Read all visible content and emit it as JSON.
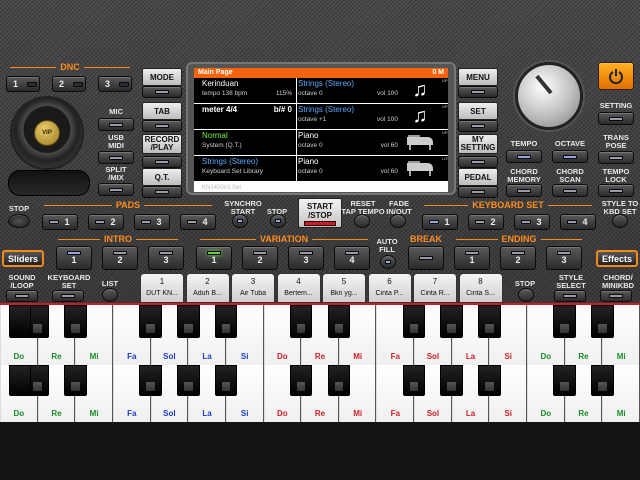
{
  "dnc": {
    "label": "DNC",
    "buttons": [
      "1",
      "2",
      "3"
    ]
  },
  "mode": {
    "label": "MODE"
  },
  "tab": {
    "label": "TAB"
  },
  "record": {
    "label": "RECORD\n/PLAY"
  },
  "qt": {
    "label": "Q.T."
  },
  "mic": {
    "label": "MIC"
  },
  "usb": {
    "label": "USB\nMIDI"
  },
  "split": {
    "label": "SPLIT\n/MIX"
  },
  "vip": {
    "label": "VIP"
  },
  "screen": {
    "header_left": "Main Page",
    "header_right": "0 M",
    "rows": [
      {
        "l1": "Kerinduan",
        "l2a": "tempo 138 bpm",
        "l2b": "115%",
        "r1": "Strings (Stereo)",
        "r2a": "octave 0",
        "r2b": "vol 100",
        "side": "UP1",
        "pic": "note"
      },
      {
        "l1": "meter 4/4",
        "l1b": "b/# 0",
        "l2a": "",
        "l2b": "",
        "r1": "Strings (Stereo)",
        "r2a": "octave +1",
        "r2b": "vol 100",
        "side": "UP2",
        "pic": "note"
      },
      {
        "l1": "Normal",
        "l2a": "System (Q.T.)",
        "l2b": "",
        "r1": "Piano",
        "r2a": "octave 0",
        "r2b": "vol 60",
        "side": "UP3",
        "pic": "piano"
      },
      {
        "l1": "Strings (Stereo)",
        "l2a": "Keyboard Set Library",
        "l2b": "",
        "r1": "Piano",
        "r2a": "octave 0",
        "r2b": "vol 60",
        "side": "LOW",
        "pic": "piano"
      }
    ],
    "footer": "KN1400#3.Set"
  },
  "menu": {
    "label": "MENU"
  },
  "set": {
    "label": "SET"
  },
  "my_setting": {
    "label": "MY\nSETTING"
  },
  "pedal": {
    "label": "PEDAL"
  },
  "setting": {
    "label": "SETTING"
  },
  "transpose": {
    "label": "TRANS\nPOSE"
  },
  "tempo": {
    "label": "TEMPO"
  },
  "octave": {
    "label": "OCTAVE"
  },
  "chord_memory": {
    "label": "CHORD\nMEMORY"
  },
  "chord_scan": {
    "label": "CHORD\nSCAN"
  },
  "tempo_lock": {
    "label": "TEMPO\nLOCK"
  },
  "stop": {
    "label": "STOP"
  },
  "pads": {
    "label": "PADS",
    "buttons": [
      "1",
      "2",
      "3",
      "4"
    ]
  },
  "synchro_start": {
    "label": "SYNCHRO\nSTART"
  },
  "synchro_stop": {
    "label": "STOP"
  },
  "start_stop": {
    "label": "START\n/STOP"
  },
  "reset": {
    "label": "RESET\nTAP TEMPO"
  },
  "fade": {
    "label": "FADE\nIN/OUT"
  },
  "keyboard_set": {
    "label": "KEYBOARD SET",
    "buttons": [
      "1",
      "2",
      "3",
      "4"
    ]
  },
  "style_to_kbd": {
    "label": "STYLE TO\nKBD SET"
  },
  "intro": {
    "label": "INTRO",
    "buttons": [
      "1",
      "2",
      "3"
    ]
  },
  "variation": {
    "label": "VARIATION",
    "buttons": [
      "1",
      "2",
      "3",
      "4"
    ]
  },
  "auto_fill": {
    "label": "AUTO\nFILL"
  },
  "break_lbl": {
    "label": "BREAK"
  },
  "ending": {
    "label": "ENDING",
    "buttons": [
      "1",
      "2",
      "3"
    ]
  },
  "sliders": {
    "label": "Sliders"
  },
  "effects": {
    "label": "Effects"
  },
  "sound_loop": {
    "label": "SOUND\n/LOOP"
  },
  "keyboard_set2": {
    "label": "KEYBOARD\nSET"
  },
  "list": {
    "label": "LIST"
  },
  "stop2": {
    "label": "STOP"
  },
  "style_select": {
    "label": "STYLE\nSELECT"
  },
  "chord_mini": {
    "label": "CHORD/\nMINIKBD"
  },
  "songs": [
    {
      "num": "1",
      "name": "DUT KN..."
    },
    {
      "num": "2",
      "name": "Aduh B..."
    },
    {
      "num": "3",
      "name": "Air Tuba"
    },
    {
      "num": "4",
      "name": "Bertem..."
    },
    {
      "num": "5",
      "name": "Bkn yg..."
    },
    {
      "num": "6",
      "name": "Cinta P..."
    },
    {
      "num": "7",
      "name": "Cinta R..."
    },
    {
      "num": "8",
      "name": "Cinta S..."
    }
  ],
  "keys": [
    "Do",
    "Re",
    "Mi",
    "Fa",
    "Sol",
    "La",
    "Si",
    "Do",
    "Re",
    "Mi",
    "Fa",
    "Sol",
    "La",
    "Si",
    "Do",
    "Re",
    "Mi"
  ],
  "key_colors": [
    "#1a8c2a",
    "#1a8c2a",
    "#1a8c2a",
    "#1a3cc8",
    "#1a3cc8",
    "#1a3cc8",
    "#1a3cc8",
    "#d0202a",
    "#d0202a",
    "#d0202a",
    "#d0202a",
    "#d0202a",
    "#d0202a",
    "#d0202a",
    "#1a8c2a",
    "#1a8c2a",
    "#1a8c2a"
  ],
  "accent": "#ff8c1a"
}
